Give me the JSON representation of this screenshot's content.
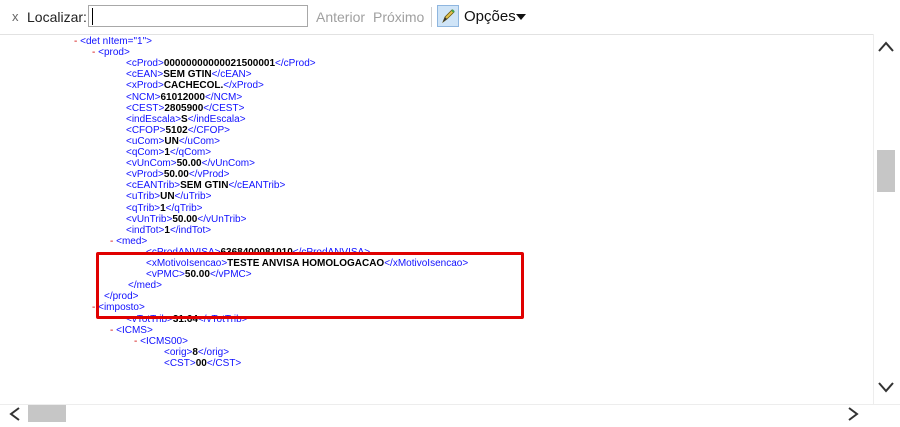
{
  "findbar": {
    "close_glyph": "x",
    "label": "Localizar:",
    "input_value": "",
    "prev_label": "Anterior",
    "next_label": "Próximo",
    "options_label": "Opções"
  },
  "xml_lines": [
    {
      "toggle": "- ",
      "open": "<det nItem=\"1\">",
      "value": "",
      "close": ""
    },
    {
      "toggle": "- ",
      "open": "<prod>",
      "value": "",
      "close": ""
    },
    {
      "toggle": "",
      "open": "<cProd>",
      "value": "00000000000021500001",
      "close": "</cProd>"
    },
    {
      "toggle": "",
      "open": "<cEAN>",
      "value": "SEM GTIN",
      "close": "</cEAN>"
    },
    {
      "toggle": "",
      "open": "<xProd>",
      "value": "CACHECOL.",
      "close": "</xProd>"
    },
    {
      "toggle": "",
      "open": "<NCM>",
      "value": "61012000",
      "close": "</NCM>"
    },
    {
      "toggle": "",
      "open": "<CEST>",
      "value": "2805900",
      "close": "</CEST>"
    },
    {
      "toggle": "",
      "open": "<indEscala>",
      "value": "S",
      "close": "</indEscala>"
    },
    {
      "toggle": "",
      "open": "<CFOP>",
      "value": "5102",
      "close": "</CFOP>"
    },
    {
      "toggle": "",
      "open": "<uCom>",
      "value": "UN",
      "close": "</uCom>"
    },
    {
      "toggle": "",
      "open": "<qCom>",
      "value": "1",
      "close": "</qCom>"
    },
    {
      "toggle": "",
      "open": "<vUnCom>",
      "value": "50.00",
      "close": "</vUnCom>"
    },
    {
      "toggle": "",
      "open": "<vProd>",
      "value": "50.00",
      "close": "</vProd>"
    },
    {
      "toggle": "",
      "open": "<cEANTrib>",
      "value": "SEM GTIN",
      "close": "</cEANTrib>"
    },
    {
      "toggle": "",
      "open": "<uTrib>",
      "value": "UN",
      "close": "</uTrib>"
    },
    {
      "toggle": "",
      "open": "<qTrib>",
      "value": "1",
      "close": "</qTrib>"
    },
    {
      "toggle": "",
      "open": "<vUnTrib>",
      "value": "50.00",
      "close": "</vUnTrib>"
    },
    {
      "toggle": "",
      "open": "<indTot>",
      "value": "1",
      "close": "</indTot>"
    },
    {
      "toggle": "- ",
      "open": "<med>",
      "value": "",
      "close": ""
    },
    {
      "toggle": "",
      "open": "<cProdANVISA>",
      "value": "6368400081010",
      "close": "</cProdANVISA>"
    },
    {
      "toggle": "",
      "open": "<xMotivoIsencao>",
      "value": "TESTE ANVISA HOMOLOGACAO",
      "close": "</xMotivoIsencao>"
    },
    {
      "toggle": "",
      "open": "<vPMC>",
      "value": "50.00",
      "close": "</vPMC>"
    },
    {
      "toggle": "",
      "open": "</med>",
      "value": "",
      "close": ""
    },
    {
      "toggle": "",
      "open": "</prod>",
      "value": "",
      "close": ""
    },
    {
      "toggle": "- ",
      "open": "<imposto>",
      "value": "",
      "close": ""
    },
    {
      "toggle": "",
      "open": "<vTotTrib>",
      "value": "31.64",
      "close": "</vTotTrib>"
    },
    {
      "toggle": "- ",
      "open": "<ICMS>",
      "value": "",
      "close": ""
    },
    {
      "toggle": "- ",
      "open": "<ICMS00>",
      "value": "",
      "close": ""
    },
    {
      "toggle": "",
      "open": "<orig>",
      "value": "8",
      "close": "</orig>"
    },
    {
      "toggle": "",
      "open": "<CST>",
      "value": "00",
      "close": "</CST>"
    }
  ],
  "colors": {
    "tag": "#1010ff",
    "toggle": "#d00000",
    "highlight": "#e00000",
    "value": "#000000"
  },
  "icons": {
    "close": "close-icon",
    "pencil": "pencil-icon",
    "dropdown": "chevron-down-icon",
    "scroll_up": "chevron-up-icon",
    "scroll_down": "chevron-down-icon",
    "scroll_left": "chevron-left-icon",
    "scroll_right": "chevron-right-icon"
  }
}
